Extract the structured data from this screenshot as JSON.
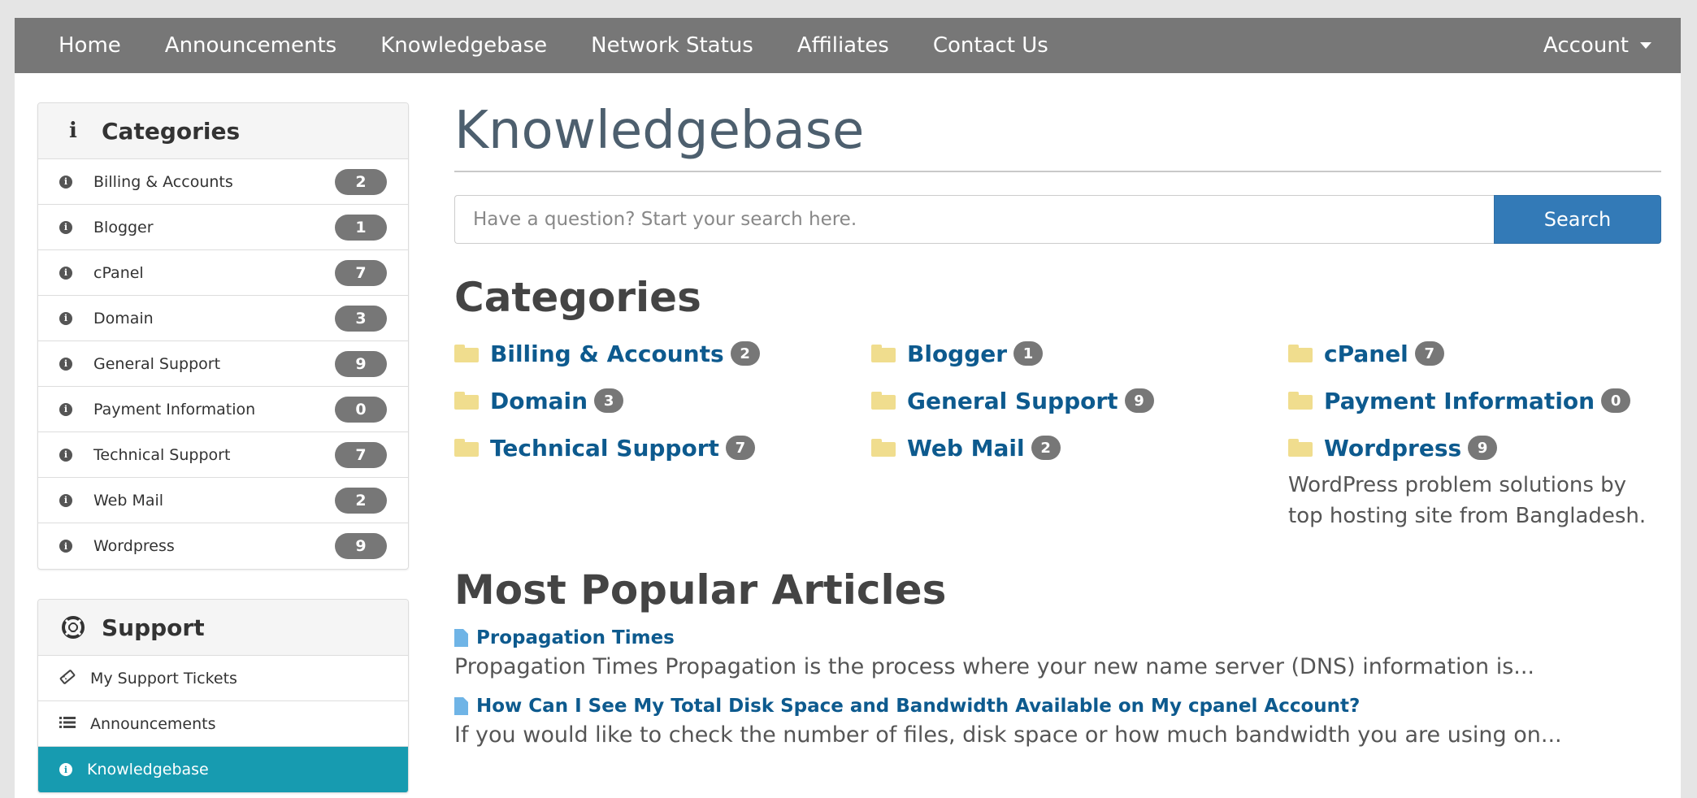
{
  "topnav": {
    "items": [
      "Home",
      "Announcements",
      "Knowledgebase",
      "Network Status",
      "Affiliates",
      "Contact Us"
    ],
    "account": "Account"
  },
  "sidebar": {
    "categories": {
      "title": "Categories",
      "icon": "info-icon",
      "items": [
        {
          "label": "Billing & Accounts",
          "count": "2"
        },
        {
          "label": "Blogger",
          "count": "1"
        },
        {
          "label": "cPanel",
          "count": "7"
        },
        {
          "label": "Domain",
          "count": "3"
        },
        {
          "label": "General Support",
          "count": "9"
        },
        {
          "label": "Payment Information",
          "count": "0"
        },
        {
          "label": "Technical Support",
          "count": "7"
        },
        {
          "label": "Web Mail",
          "count": "2"
        },
        {
          "label": "Wordpress",
          "count": "9"
        }
      ]
    },
    "support": {
      "title": "Support",
      "icon": "lifebuoy-icon",
      "items": [
        {
          "label": "My Support Tickets",
          "icon": "ticket-icon"
        },
        {
          "label": "Announcements",
          "icon": "list-icon"
        },
        {
          "label": "Knowledgebase",
          "icon": "info-icon",
          "active": true
        }
      ]
    }
  },
  "main": {
    "title": "Knowledgebase",
    "search": {
      "placeholder": "Have a question? Start your search here.",
      "button": "Search"
    },
    "categories_title": "Categories",
    "categories": [
      {
        "name": "Billing & Accounts",
        "count": "2"
      },
      {
        "name": "Blogger",
        "count": "1"
      },
      {
        "name": "cPanel",
        "count": "7"
      },
      {
        "name": "Domain",
        "count": "3"
      },
      {
        "name": "General Support",
        "count": "9"
      },
      {
        "name": "Payment Information",
        "count": "0"
      },
      {
        "name": "Technical Support",
        "count": "7"
      },
      {
        "name": "Web Mail",
        "count": "2"
      },
      {
        "name": "Wordpress",
        "count": "9"
      }
    ],
    "wordpress_description": "WordPress problem solutions by top hosting site from Bangladesh.",
    "popular_title": "Most Popular Articles",
    "articles": [
      {
        "title": "Propagation Times",
        "excerpt": "Propagation Times   Propagation is the process where your new name server (DNS) information is..."
      },
      {
        "title": "How Can I See My Total Disk Space and Bandwidth Available on My cpanel Account?",
        "excerpt": "If you would like to check the number of files, disk space or how much bandwidth you are using on..."
      }
    ]
  },
  "colors": {
    "nav_bg": "#777777",
    "link": "#0d5a8e",
    "active": "#179bb0",
    "button": "#337ab7",
    "folder": "#f0dd8e"
  }
}
